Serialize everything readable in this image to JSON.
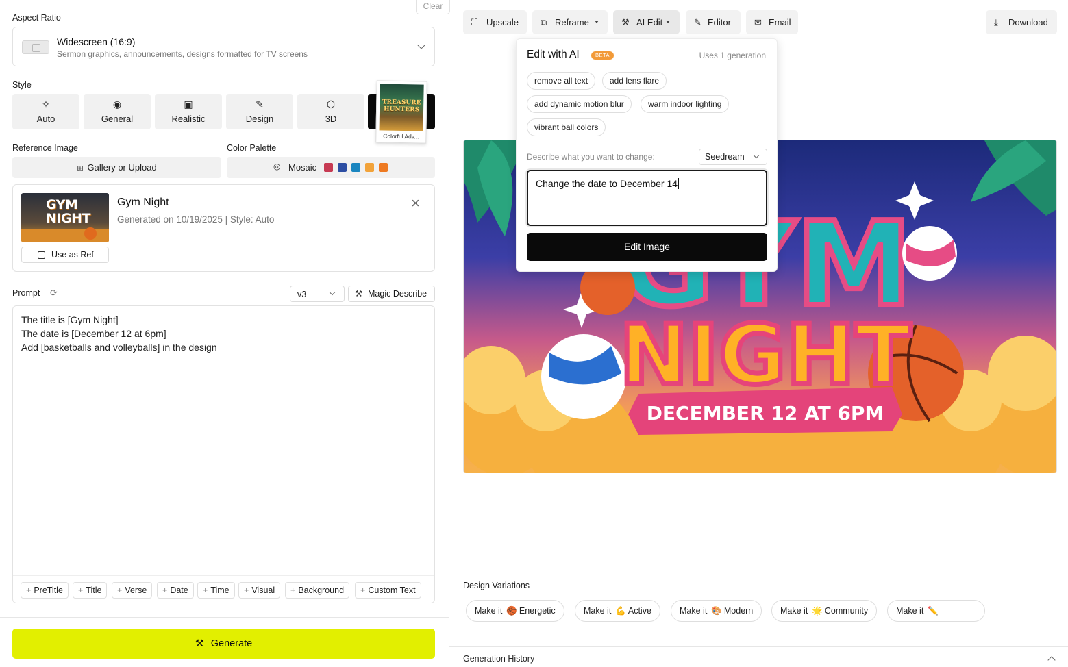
{
  "left": {
    "clear_label": "Clear",
    "aspect": {
      "label": "Aspect Ratio",
      "title": "Widescreen (16:9)",
      "subtitle": "Sermon graphics, announcements, designs formatted for TV screens"
    },
    "style": {
      "label": "Style",
      "options": [
        {
          "label": "Auto",
          "icon": "sparkle-icon"
        },
        {
          "label": "General",
          "icon": "palette-icon"
        },
        {
          "label": "Realistic",
          "icon": "image-icon"
        },
        {
          "label": "Design",
          "icon": "pen-icon"
        },
        {
          "label": "3D",
          "icon": "cube-icon"
        }
      ],
      "selected_preview_text": "TREASURE HUNTERS",
      "selected_preview_caption": "Colorful Adv..."
    },
    "reference_image": {
      "label": "Reference Image",
      "button": "Gallery or Upload"
    },
    "color_palette": {
      "label": "Color Palette",
      "name": "Mosaic",
      "colors": [
        "#c73b53",
        "#2d4ea3",
        "#1b86c0",
        "#f2a33a",
        "#ee7a22"
      ]
    },
    "generation": {
      "thumb_text": "GYM NIGHT",
      "title": "Gym Night",
      "meta": "Generated on 10/19/2025 | Style: Auto",
      "use_as_ref": "Use as Ref"
    },
    "prompt": {
      "label": "Prompt",
      "version": "v3",
      "magic_label": "Magic Describe",
      "lines": [
        "The title is [Gym Night]",
        "The date is [December 12 at 6pm]",
        "Add [basketballs and volleyballs] in the design"
      ],
      "tags": [
        "PreTitle",
        "Title",
        "Verse",
        "Date",
        "Time",
        "Visual",
        "Background",
        "Custom Text"
      ]
    },
    "generate_label": "Generate"
  },
  "toolbar": {
    "upscale": "Upscale",
    "reframe": "Reframe",
    "ai_edit": "AI Edit",
    "editor": "Editor",
    "email": "Email",
    "download": "Download"
  },
  "ai_edit": {
    "title": "Edit with AI",
    "badge": "BETA",
    "uses": "Uses 1 generation",
    "suggestions": [
      "remove all text",
      "add lens flare",
      "add dynamic motion blur",
      "warm indoor lighting",
      "vibrant ball colors"
    ],
    "describe_label": "Describe what you want to change:",
    "model": "Seedream",
    "input_value": "Change the date to December 14",
    "submit": "Edit Image"
  },
  "main_image": {
    "title_top": "GYM",
    "title_bottom": "NIGHT",
    "banner": "DECEMBER 12 AT 6PM"
  },
  "variations": {
    "label": "Design Variations",
    "items": [
      {
        "prefix": "Make it",
        "emoji": "🏀",
        "word": "Energetic"
      },
      {
        "prefix": "Make it",
        "emoji": "💪",
        "word": "Active"
      },
      {
        "prefix": "Make it",
        "emoji": "🎨",
        "word": "Modern"
      },
      {
        "prefix": "Make it",
        "emoji": "🌟",
        "word": "Community"
      },
      {
        "prefix": "Make it",
        "emoji": "✏️",
        "word": ""
      }
    ]
  },
  "history_label": "Generation History"
}
